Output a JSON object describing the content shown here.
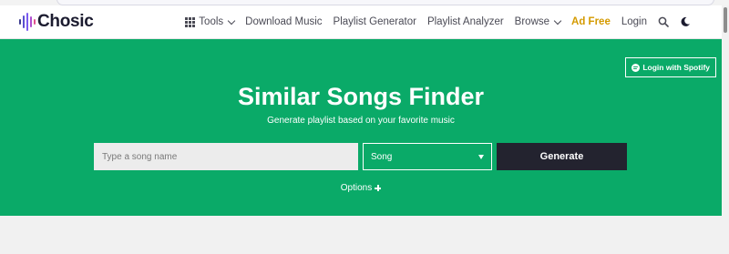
{
  "header": {
    "logo_text": "Chosic",
    "nav": [
      {
        "label": "Tools",
        "icon": "grid-icon",
        "dropdown": true
      },
      {
        "label": "Download Music"
      },
      {
        "label": "Playlist Generator"
      },
      {
        "label": "Playlist Analyzer"
      },
      {
        "label": "Browse",
        "dropdown": true
      },
      {
        "label": "Ad Free",
        "color": "#d49a00"
      },
      {
        "label": "Login"
      }
    ],
    "icons": [
      "search-icon",
      "dark-mode-icon"
    ]
  },
  "hero": {
    "background": "#0aaa68",
    "login_spotify": "Login with Spotify",
    "title": "Similar Songs Finder",
    "subtitle": "Generate playlist based on your favorite music",
    "search": {
      "placeholder": "Type a song name",
      "value": ""
    },
    "type_select": {
      "selected": "Song"
    },
    "generate_label": "Generate",
    "options_label": "Options"
  }
}
